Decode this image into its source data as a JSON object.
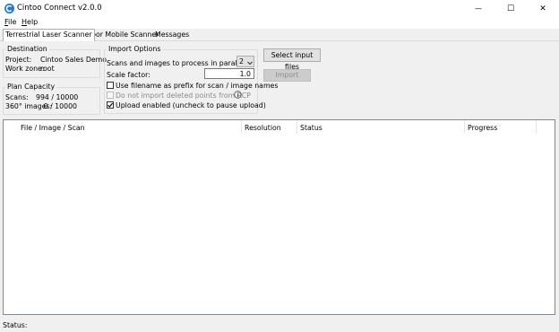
{
  "window": {
    "title": "Cintoo Connect v2.0.0",
    "minimize_glyph": "—",
    "maximize_glyph": "☐",
    "close_glyph": "✕"
  },
  "menu": {
    "file": {
      "accel": "F",
      "rest": "ile"
    },
    "help": {
      "accel": "H",
      "rest": "elp"
    }
  },
  "tabs": [
    "Terrestrial Laser Scanner",
    "Indoor Mobile Scanner",
    "Messages"
  ],
  "destination": {
    "title": "Destination",
    "project_label": "Project:",
    "project_value": "Cintoo Sales Demo",
    "workzone_label": "Work zone:",
    "workzone_value": "root"
  },
  "plan_capacity": {
    "title": "Plan Capacity",
    "scans_label": "Scans:",
    "scans_value": "994 / 10000",
    "images_label": "360° images:",
    "images_value": "0 / 10000"
  },
  "import_options": {
    "title": "Import Options",
    "parallel_label": "Scans and images to process in parallel:",
    "parallel_value": "2",
    "scale_label": "Scale factor:",
    "scale_value": "1.0",
    "prefix_label": "Use filename as prefix for scan / image names",
    "prefix_checked": false,
    "deleted_label": "Do not import deleted points from RCP",
    "deleted_checked": false,
    "deleted_disabled": true,
    "upload_label": "Upload enabled (uncheck to pause upload)",
    "upload_checked": true
  },
  "buttons": {
    "select_input": "Select input files",
    "import": "Import"
  },
  "list": {
    "columns": [
      "File / Image / Scan",
      "Resolution",
      "Status",
      "Progress"
    ]
  },
  "status": {
    "label": "Status:"
  },
  "colors": {
    "accent": "#1e7ad8",
    "disabled_text": "#8a8a8a"
  }
}
